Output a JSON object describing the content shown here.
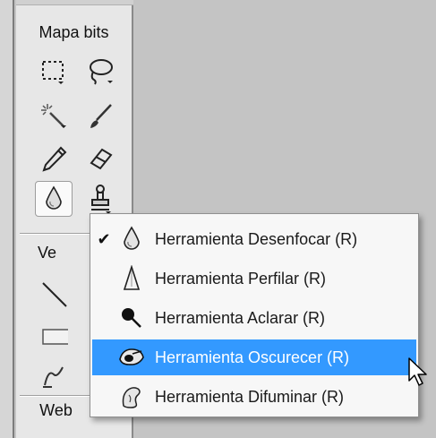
{
  "panel": {
    "section_bitmap": "Mapa bits",
    "section_vector": "Ve",
    "section_web": "Web"
  },
  "tools": [
    {
      "name": "marquee",
      "icon": "marquee-icon"
    },
    {
      "name": "lasso",
      "icon": "lasso-icon"
    },
    {
      "name": "magic-wand",
      "icon": "magic-wand-icon"
    },
    {
      "name": "brush",
      "icon": "brush-icon"
    },
    {
      "name": "pencil",
      "icon": "pencil-icon"
    },
    {
      "name": "eraser",
      "icon": "eraser-icon"
    },
    {
      "name": "blur",
      "icon": "blur-drop-icon",
      "active": true
    },
    {
      "name": "rubber-stamp",
      "icon": "rubber-stamp-icon"
    }
  ],
  "menu": {
    "items": [
      {
        "label": "Herramienta Desenfocar (R)",
        "checked": true,
        "icon": "blur-drop-icon"
      },
      {
        "label": "Herramienta Perfilar (R)",
        "checked": false,
        "icon": "sharpen-icon"
      },
      {
        "label": "Herramienta Aclarar (R)",
        "checked": false,
        "icon": "dodge-icon"
      },
      {
        "label": "Herramienta Oscurecer (R)",
        "checked": false,
        "icon": "burn-icon",
        "highlighted": true
      },
      {
        "label": "Herramienta Difuminar (R)",
        "checked": false,
        "icon": "smudge-icon"
      }
    ],
    "check_glyph": "✔"
  },
  "colors": {
    "highlight": "#3399ff",
    "menu_bg": "#f7f7f7",
    "panel_bg": "#e7e7e7"
  }
}
